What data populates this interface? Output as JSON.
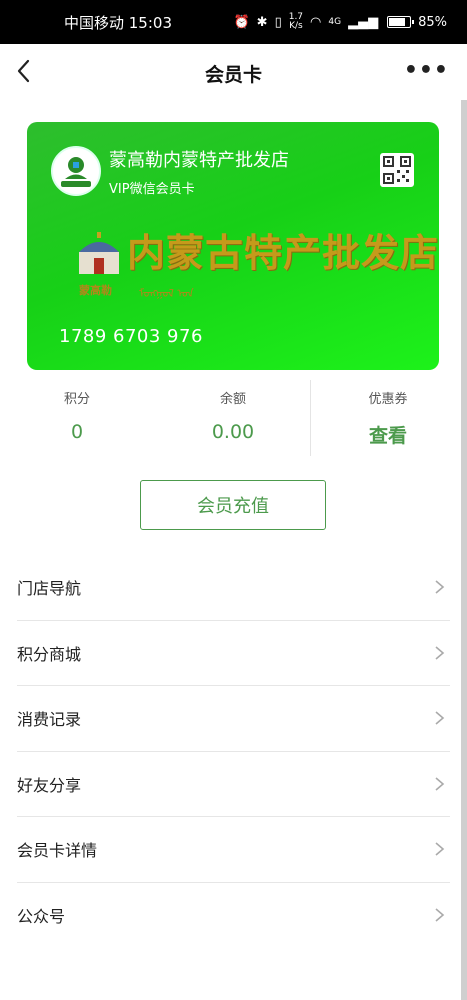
{
  "status_bar": {
    "carrier_time": "中国移动 15:03",
    "net_speed_value": "1.7",
    "net_speed_unit": "K/s",
    "signal_label": "4G",
    "battery": "85%"
  },
  "nav": {
    "title": "会员卡"
  },
  "card": {
    "store_name": "蒙高勒内蒙特产批发店",
    "card_type": "VIP微信会员卡",
    "banner_text": "内蒙古特产批发店",
    "banner_sub": "蒙高勒",
    "mongol_text": "ᠮᠣᠩᠭᠣᠯ ᠤᠨ",
    "card_number": "1789 6703 976",
    "colors": {
      "start": "#2ebd2e",
      "end": "#1df21a",
      "banner": "#c59a1b"
    }
  },
  "stats": [
    {
      "label": "积分",
      "value": "0"
    },
    {
      "label": "余额",
      "value": "0.00"
    },
    {
      "label": "优惠券",
      "value": "查看"
    }
  ],
  "recharge_label": "会员充值",
  "menu": [
    {
      "label": "门店导航"
    },
    {
      "label": "积分商城"
    },
    {
      "label": "消费记录"
    },
    {
      "label": "好友分享"
    },
    {
      "label": "会员卡详情"
    },
    {
      "label": "公众号"
    }
  ],
  "accent_color": "#4c9a4c"
}
